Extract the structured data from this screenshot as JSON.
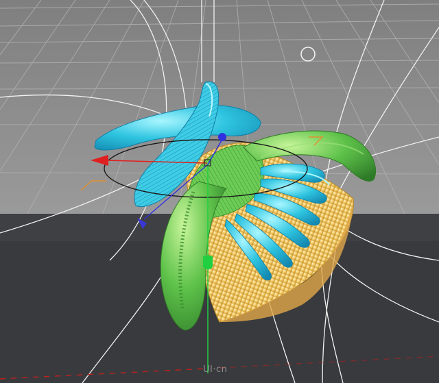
{
  "viewport": {
    "background_top": "#8f8f8f",
    "background_floor": "#3a3b3e",
    "grid_color": "#b4b4b4",
    "spline_color": "#f2f2f2"
  },
  "object": {
    "colors": {
      "cyan": "#2ec4e0",
      "cyan_light": "#8ff0ff",
      "green": "#5ec24a",
      "green_light": "#b8f08a",
      "yellow": "#f4c860",
      "yellow_light": "#ffeab0"
    }
  },
  "gizmo": {
    "axis_x_color": "#e02020",
    "axis_y_color": "#20d040",
    "axis_z_color": "#3030e0",
    "rotate_ring_color": "#1a1a1a"
  },
  "watermark": {
    "text": "UI·cn"
  }
}
